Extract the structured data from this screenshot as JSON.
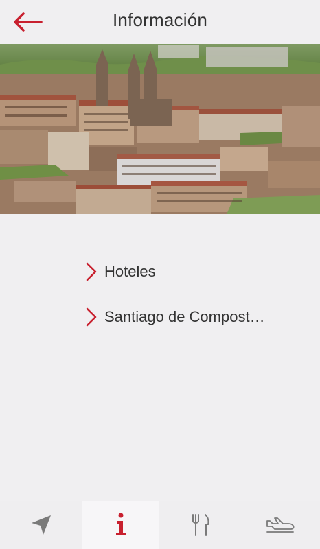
{
  "header": {
    "title": "Información",
    "back_icon": "arrow-left-icon"
  },
  "hero": {
    "icon": "city-photo"
  },
  "menu": {
    "items": [
      {
        "label": "Hoteles",
        "icon": "chevron-right-icon"
      },
      {
        "label": "Santiago de Compost…",
        "icon": "chevron-right-icon"
      }
    ]
  },
  "tabbar": {
    "tabs": [
      {
        "icon": "location-arrow-icon",
        "active": false
      },
      {
        "icon": "info-icon",
        "active": true
      },
      {
        "icon": "fork-knife-icon",
        "active": false
      },
      {
        "icon": "airplane-icon",
        "active": false
      }
    ]
  },
  "colors": {
    "accent": "#c8202f",
    "inactive_icon": "#7a7a7a",
    "background": "#f0eff1",
    "text": "#333333"
  }
}
